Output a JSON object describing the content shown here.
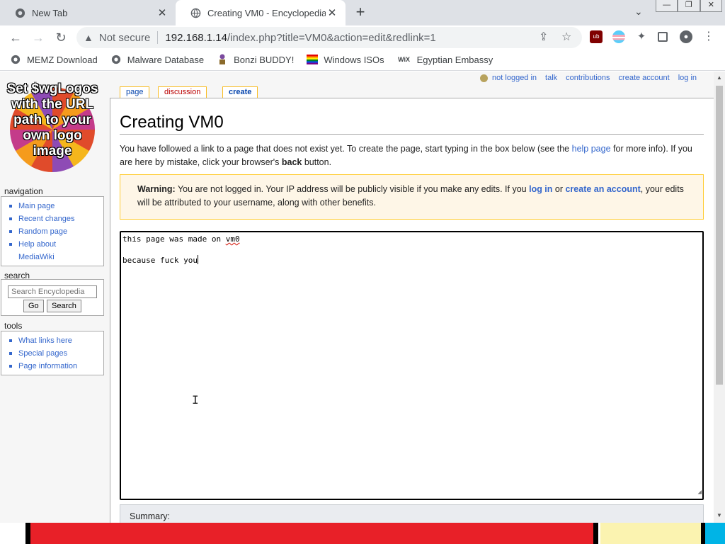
{
  "browser": {
    "tabs": [
      {
        "title": "New Tab",
        "active": false
      },
      {
        "title": "Creating VM0 - Encyclopedia",
        "active": true
      }
    ],
    "omnibox": {
      "security_label": "Not secure",
      "url_host": "192.168.1.14",
      "url_path": "/index.php?title=VM0&action=edit&redlink=1"
    },
    "bookmarks": [
      {
        "label": "MEMZ Download",
        "icon": "globe-icon"
      },
      {
        "label": "Malware Database",
        "icon": "globe-icon"
      },
      {
        "label": "Bonzi BUDDY!",
        "icon": "bonzi-icon"
      },
      {
        "label": "Windows ISOs",
        "icon": "rainbow-flag-icon"
      },
      {
        "label": "Egyptian Embassy",
        "icon": "wix-icon"
      }
    ]
  },
  "wiki": {
    "logo_text": "Set $wgLogos with the URL path to your own logo image",
    "personal_tools": [
      "not logged in",
      "talk",
      "contributions",
      "create account",
      "log in"
    ],
    "content_tabs": [
      {
        "label": "page",
        "color": "#0645ad"
      },
      {
        "label": "discussion",
        "color": "#ba0000"
      },
      {
        "label": "create",
        "color": "#0645ad"
      }
    ],
    "navigation": {
      "heading": "navigation",
      "items": [
        "Main page",
        "Recent changes",
        "Random page",
        "Help about MediaWiki"
      ]
    },
    "search": {
      "heading": "search",
      "placeholder": "Search Encyclopedia",
      "go_label": "Go",
      "search_label": "Search"
    },
    "tools": {
      "heading": "tools",
      "items": [
        "What links here",
        "Special pages",
        "Page information"
      ]
    },
    "page_title": "Creating VM0",
    "intro": {
      "before_link": "You have followed a link to a page that does not exist yet. To create the page, start typing in the box below (see the ",
      "link": "help page",
      "after_link": " for more info). If you are here by mistake, click your browser's ",
      "bold": "back",
      "end": " button."
    },
    "warning": {
      "label": "Warning:",
      "text1": " You are not logged in. Your IP address will be publicly visible if you make any edits. If you ",
      "login_link": "log in",
      "text2": " or ",
      "create_link": "create an account",
      "text3": ", your edits will be attributed to your username, along with other benefits."
    },
    "editor": {
      "line1_prefix": "this page was made on ",
      "line1_word": "vm0",
      "line2": "because fuck you"
    },
    "summary_label": "Summary:"
  }
}
